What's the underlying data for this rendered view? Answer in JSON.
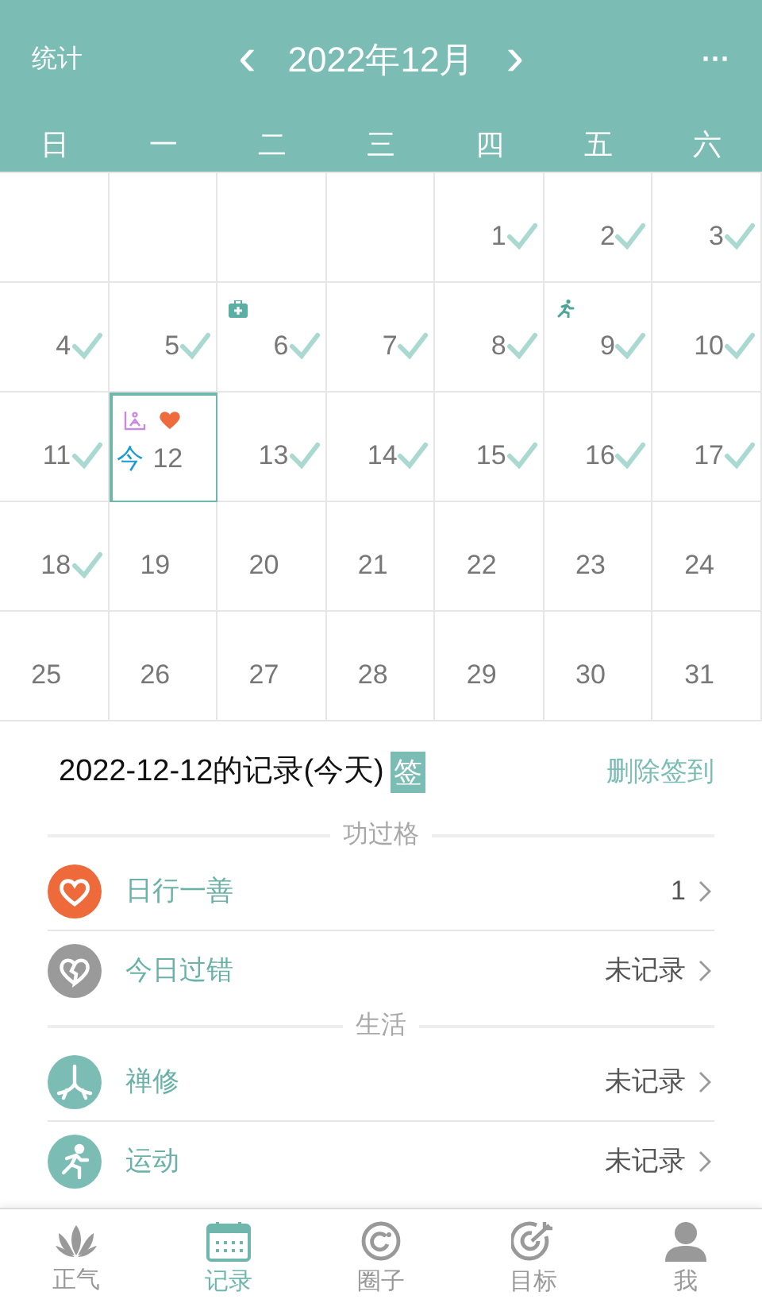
{
  "header": {
    "left": "统计",
    "prev": "‹",
    "month": "2022年12月",
    "next": "›",
    "more": "···"
  },
  "weekdays": [
    "日",
    "一",
    "二",
    "三",
    "四",
    "五",
    "六"
  ],
  "days": [
    {
      "kind": "empty"
    },
    {
      "kind": "empty"
    },
    {
      "kind": "empty"
    },
    {
      "kind": "empty"
    },
    {
      "kind": "day",
      "day": "1",
      "checked": true,
      "selected": false
    },
    {
      "kind": "day",
      "day": "2",
      "checked": true,
      "selected": false
    },
    {
      "kind": "day",
      "day": "3",
      "checked": true,
      "selected": false
    },
    {
      "kind": "day",
      "day": "4",
      "checked": true,
      "selected": false
    },
    {
      "kind": "day",
      "day": "5",
      "checked": true,
      "selected": false
    },
    {
      "kind": "day",
      "day": "6",
      "checked": true,
      "selected": false,
      "icons": [
        {
          "kind": "medical"
        }
      ]
    },
    {
      "kind": "day",
      "day": "7",
      "checked": true,
      "selected": false
    },
    {
      "kind": "day",
      "day": "8",
      "checked": true,
      "selected": false
    },
    {
      "kind": "day",
      "day": "9",
      "checked": true,
      "selected": false,
      "icons": [
        {
          "kind": "run"
        }
      ]
    },
    {
      "kind": "day",
      "day": "10",
      "checked": true,
      "selected": false
    },
    {
      "kind": "day",
      "day": "11",
      "checked": true,
      "selected": false
    },
    {
      "kind": "day",
      "day": "12",
      "checked": false,
      "selected": true,
      "today": "今",
      "icons": [
        {
          "kind": "meditation"
        },
        {
          "kind": "heart"
        }
      ]
    },
    {
      "kind": "day",
      "day": "13",
      "checked": true,
      "selected": false
    },
    {
      "kind": "day",
      "day": "14",
      "checked": true,
      "selected": false
    },
    {
      "kind": "day",
      "day": "15",
      "checked": true,
      "selected": false
    },
    {
      "kind": "day",
      "day": "16",
      "checked": true,
      "selected": false
    },
    {
      "kind": "day",
      "day": "17",
      "checked": true,
      "selected": false
    },
    {
      "kind": "day",
      "day": "18",
      "checked": true,
      "selected": false
    },
    {
      "kind": "day",
      "day": "19",
      "checked": false,
      "selected": false
    },
    {
      "kind": "day",
      "day": "20",
      "checked": false,
      "selected": false
    },
    {
      "kind": "day",
      "day": "21",
      "checked": false,
      "selected": false
    },
    {
      "kind": "day",
      "day": "22",
      "checked": false,
      "selected": false
    },
    {
      "kind": "day",
      "day": "23",
      "checked": false,
      "selected": false
    },
    {
      "kind": "day",
      "day": "24",
      "checked": false,
      "selected": false
    },
    {
      "kind": "day",
      "day": "25",
      "checked": false,
      "selected": false
    },
    {
      "kind": "day",
      "day": "26",
      "checked": false,
      "selected": false
    },
    {
      "kind": "day",
      "day": "27",
      "checked": false,
      "selected": false
    },
    {
      "kind": "day",
      "day": "28",
      "checked": false,
      "selected": false
    },
    {
      "kind": "day",
      "day": "29",
      "checked": false,
      "selected": false
    },
    {
      "kind": "day",
      "day": "30",
      "checked": false,
      "selected": false
    },
    {
      "kind": "day",
      "day": "31",
      "checked": false,
      "selected": false
    }
  ],
  "record": {
    "title": "2022-12-12的记录(今天)",
    "badge": "签",
    "action": "删除签到"
  },
  "sections": [
    {
      "heading": "功过格",
      "items": [
        {
          "kind": "heart",
          "label": "日行一善",
          "value": "1"
        },
        {
          "kind": "broken-heart",
          "label": "今日过错",
          "value": "未记录"
        }
      ]
    },
    {
      "heading": "生活",
      "items": [
        {
          "kind": "meditation",
          "label": "禅修",
          "value": "未记录"
        },
        {
          "kind": "run",
          "label": "运动",
          "value": "未记录"
        }
      ]
    }
  ],
  "nav": [
    {
      "kind": "lotus",
      "label": "正气",
      "selected": false
    },
    {
      "kind": "calendar",
      "label": "记录",
      "selected": true
    },
    {
      "kind": "circle",
      "label": "圈子",
      "selected": false
    },
    {
      "kind": "target",
      "label": "目标",
      "selected": false
    },
    {
      "kind": "person",
      "label": "我",
      "selected": false
    }
  ]
}
